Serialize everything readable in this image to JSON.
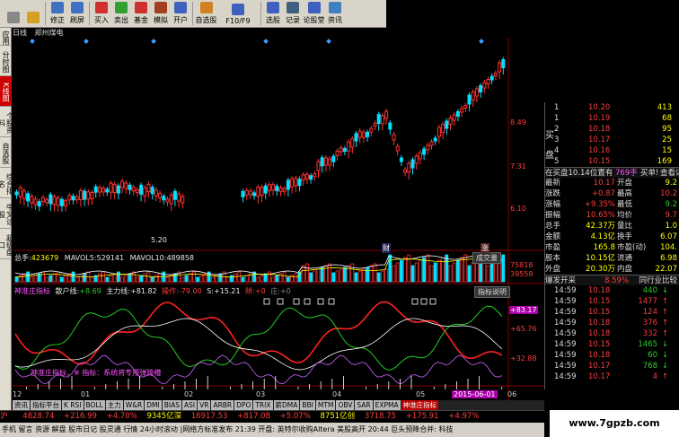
{
  "toolbar": {
    "items": [
      {
        "label": "",
        "icon": "home-icon",
        "color": "#888"
      },
      {
        "label": "",
        "icon": "star-icon",
        "color": "#d4a020"
      },
      {
        "label": "修正",
        "icon": "up-down-icon",
        "color": "#4070c0"
      },
      {
        "label": "刷屏",
        "icon": "refresh-icon",
        "color": "#4070c0"
      },
      {
        "label": "买入",
        "icon": "buy-icon",
        "color": "#d03030"
      },
      {
        "label": "卖出",
        "icon": "sell-icon",
        "color": "#30a030"
      },
      {
        "label": "基金",
        "icon": "fund-icon",
        "color": "#d03030"
      },
      {
        "label": "模拟",
        "icon": "simulate-icon",
        "color": "#a04020"
      },
      {
        "label": "开户",
        "icon": "account-icon",
        "color": "#4060c0"
      },
      {
        "label": "自选股",
        "icon": "favorites-icon",
        "color": "#d08020"
      },
      {
        "label": "F10/F9",
        "icon": "f10-icon",
        "color": "#4060c0"
      },
      {
        "label": "选股",
        "icon": "select-icon",
        "color": "#4060c0"
      },
      {
        "label": "记录",
        "icon": "record-icon",
        "color": "#406080"
      },
      {
        "label": "论股堂",
        "icon": "forum-icon",
        "color": "#4060c0"
      },
      {
        "label": "资讯",
        "icon": "news-icon",
        "color": "#4080c0"
      }
    ]
  },
  "left_nav": [
    "应用",
    "分时图",
    "K线图",
    "个股资料",
    "自选股",
    "综合排名",
    "牛叉诊股",
    "超级盘口"
  ],
  "chart_header": {
    "period": "日线",
    "stock": "郑州煤电"
  },
  "price_axis": [
    "8.49",
    "7.31",
    "6.10"
  ],
  "low_marker": "5.20",
  "tags": {
    "cai": "财",
    "zhang": "涨"
  },
  "volume": {
    "label": "总手:",
    "total": "423679",
    "mavol5_label": "MAVOL5:",
    "mavol5": "529141",
    "mavol10_label": "MAVOL10:",
    "mavol10": "489858",
    "axis": [
      "75818",
      "39558"
    ],
    "btn": "成交量"
  },
  "indicator": {
    "name": "神准庄指标",
    "sanhu_label": "散户线:",
    "sanhu": "+8.69",
    "zhuli_label": "主力线:",
    "zhuli": "+81.82",
    "caozuo_label": "操作:",
    "caozuo": "-79.00",
    "s_label": "S:",
    "s": "+15.21",
    "jing_label": "阱:",
    "jing": "+0",
    "zhuang_label": "庄:",
    "zhuang": "+0",
    "btn": "指标说明",
    "axis": [
      "+65.76",
      "+32.88"
    ],
    "cursor_val": "+83.17",
    "footnote": "神准庄指标，※ 指标：系统将专用弹跨槽"
  },
  "x_axis": [
    "12",
    "01",
    "02",
    "03",
    "04",
    "05",
    "06"
  ],
  "date_tip": "2015-06-01",
  "tabs": [
    "资讯",
    "指标平台",
    "K RSI",
    "BOLL",
    "主力",
    "W&R",
    "DMI",
    "BIAS",
    "ASI",
    "VR",
    "ARBR",
    "DPO",
    "TRIX",
    "薪DMA",
    "BBI",
    "MTM",
    "OBV",
    "SAR",
    "EXPMA",
    "神准庄指标"
  ],
  "status": {
    "sh_label": "沪",
    "sh_val": "4828.74",
    "sh_chg": "+216.99",
    "sh_pct": "+4.70%",
    "sh_amt": "9345亿深",
    "sz_val": "16917.53",
    "sz_chg": "+817.08",
    "sz_pct": "+5.07%",
    "sz_amt": "8751亿创",
    "cy_val": "3718.75",
    "cy_chg": "+175.91",
    "cy_pct": "+4.97%"
  },
  "bottom_bar": "手机 留言 资源 解盘 股市日记 股灵通 行情 24小时滚动 |网络方标准发布  21:39 开盘: 英特尔收购Altera 美股高开   20:44 巨头预降合并: 科技",
  "watermark": "www.7gpzb.com",
  "orderbook": {
    "sell_label": "买盘",
    "rows": [
      {
        "n": "1",
        "p": "10.20",
        "v": "413"
      },
      {
        "n": "1",
        "p": "10.19",
        "v": "68"
      },
      {
        "n": "2",
        "p": "10.18",
        "v": "95"
      },
      {
        "n": "3",
        "p": "10.17",
        "v": "25"
      },
      {
        "n": "4",
        "p": "10.16",
        "v": "15"
      },
      {
        "n": "5",
        "p": "10.15",
        "v": "169"
      }
    ],
    "side_labels": [
      "买",
      "盘"
    ]
  },
  "position_line": {
    "a": "在买盘10.14位置有",
    "b": "769手",
    "c": "买单!",
    "d": "查看详列"
  },
  "quote": [
    {
      "k1": "最新",
      "v1": "10.17",
      "k2": "开盘",
      "v2": "9.2"
    },
    {
      "k1": "涨跌",
      "v1": "+0.87",
      "k2": "最高",
      "v2": "10.2"
    },
    {
      "k1": "涨幅",
      "v1": "+9.35%",
      "k2": "最低",
      "v2": "9.2"
    },
    {
      "k1": "振幅",
      "v1": "10.65%",
      "k2": "均价",
      "v2": "9.7"
    },
    {
      "k1": "总手",
      "v1": "42.37万",
      "k2": "量比",
      "v2": "1.0"
    },
    {
      "k1": "金额",
      "v1": "4.13亿",
      "k2": "换手",
      "v2": "6.07"
    },
    {
      "k1": "市盈",
      "v1": "165.8",
      "k2": "市盈(动)",
      "v2": "104."
    },
    {
      "k1": "股本",
      "v1": "10.15亿",
      "k2": "流通",
      "v2": "6.98"
    },
    {
      "k1": "外盘",
      "v1": "20.30万",
      "k2": "内盘",
      "v2": "22.07"
    }
  ],
  "open_line": {
    "label": "爆发开采",
    "pct": "8.59%",
    "right": "同行业比较"
  },
  "ticks": [
    {
      "t": "14:59",
      "p": "10.18",
      "v": "440",
      "d": "down"
    },
    {
      "t": "14:59",
      "p": "10.15",
      "v": "1477",
      "d": "up"
    },
    {
      "t": "14:59",
      "p": "10.15",
      "v": "124",
      "d": "up"
    },
    {
      "t": "14:59",
      "p": "10.18",
      "v": "376",
      "d": "up"
    },
    {
      "t": "14:59",
      "p": "10.18",
      "v": "332",
      "d": "up"
    },
    {
      "t": "14:59",
      "p": "10.15",
      "v": "1465",
      "d": "down"
    },
    {
      "t": "14:59",
      "p": "10.18",
      "v": "60",
      "d": "down"
    },
    {
      "t": "14:59",
      "p": "10.17",
      "v": "768",
      "d": "down"
    },
    {
      "t": "14:59",
      "p": "10.17",
      "v": "4",
      "d": "up"
    }
  ]
}
